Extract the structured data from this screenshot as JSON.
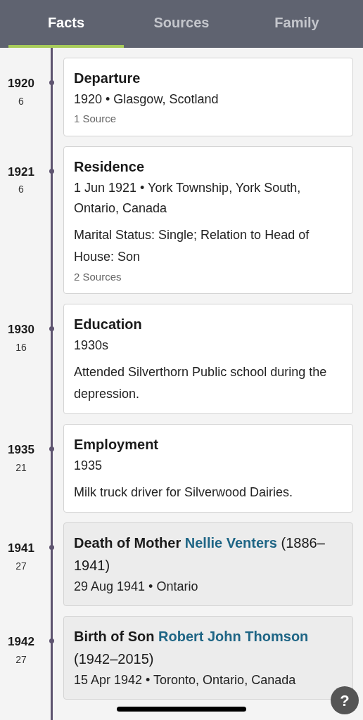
{
  "tabs": [
    {
      "label": "Facts",
      "selected": true
    },
    {
      "label": "Sources",
      "selected": false
    },
    {
      "label": "Family",
      "selected": false
    }
  ],
  "events": [
    {
      "kind": "fact",
      "year": "1920",
      "age": "6",
      "title": "Departure",
      "date_place": "1920 • Glasgow, Scotland",
      "sources": "1 Source"
    },
    {
      "kind": "fact",
      "year": "1921",
      "age": "6",
      "title": "Residence",
      "date_place": "1 Jun 1921 • York Township, York South, Ontario, Canada",
      "description": "Marital Status: Single; Relation to Head of House: Son",
      "sources": "2 Sources"
    },
    {
      "kind": "fact",
      "year": "1930",
      "age": "16",
      "title": "Education",
      "date_place": "1930s",
      "description": "Attended Silverthorn Public school during the depression."
    },
    {
      "kind": "fact",
      "year": "1935",
      "age": "21",
      "title": "Employment",
      "date_place": "1935",
      "description": "Milk truck driver for Silverwood Dairies."
    },
    {
      "kind": "family",
      "year": "1941",
      "age": "27",
      "title": "Death of Mother",
      "person": "Nellie Venters",
      "lifespan": "(1886–1941)",
      "date_place": "29 Aug 1941 • Ontario"
    },
    {
      "kind": "family",
      "year": "1942",
      "age": "27",
      "title": "Birth of Son",
      "person": "Robert John Thomson",
      "lifespan": "(1942–2015)",
      "date_place": "15 Apr 1942 • Toronto, Ontario, Canada"
    }
  ],
  "help_button": "?"
}
